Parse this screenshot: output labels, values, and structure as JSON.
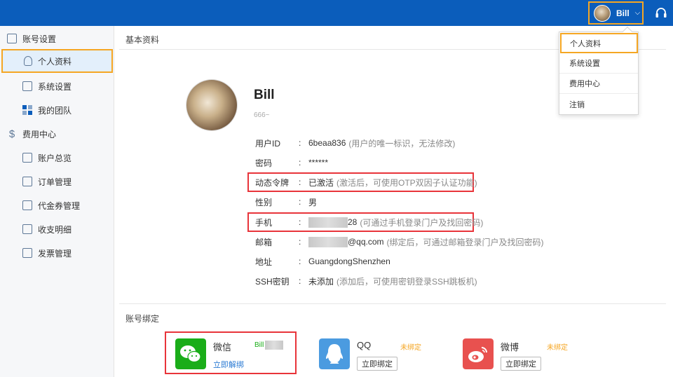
{
  "header": {
    "user_name": "Bill",
    "accent": "#0b5dbb"
  },
  "sidebar": {
    "groups": [
      {
        "label": "账号设置",
        "items": [
          {
            "label": "个人资料",
            "active": true
          },
          {
            "label": "系统设置"
          },
          {
            "label": "我的团队"
          }
        ]
      },
      {
        "label": "费用中心",
        "items": [
          {
            "label": "账户总览"
          },
          {
            "label": "订单管理"
          },
          {
            "label": "代金券管理"
          },
          {
            "label": "收支明细"
          },
          {
            "label": "发票管理"
          }
        ]
      }
    ]
  },
  "main": {
    "section_title": "基本资料",
    "profile": {
      "name": "Bill",
      "subtitle": "666~"
    },
    "fields": [
      {
        "key": "用户ID",
        "value": "6beaa836",
        "hint": "(用户的唯一标识，无法修改)"
      },
      {
        "key": "密码",
        "value": "******",
        "hint": ""
      },
      {
        "key": "动态令牌",
        "value": "已激活",
        "hint": "(激活后，可使用OTP双因子认证功能)"
      },
      {
        "key": "性别",
        "value": "男",
        "hint": ""
      },
      {
        "key": "手机",
        "value": "28",
        "hint": "(可通过手机登录门户及找回密码)"
      },
      {
        "key": "邮箱",
        "value": "@qq.com",
        "hint": "(绑定后，可通过邮箱登录门户及找回密码)"
      },
      {
        "key": "地址",
        "value": "GuangdongShenzhen",
        "hint": ""
      },
      {
        "key": "SSH密钥",
        "value": "未添加",
        "hint": "(添加后，可使用密钥登录SSH跳板机)"
      }
    ],
    "binding_title": "账号绑定",
    "bindings": [
      {
        "name": "微信",
        "status": "Bill",
        "action": "立即解绑",
        "icon": "wechat-icon",
        "color": "#1aad19"
      },
      {
        "name": "QQ",
        "status": "未绑定",
        "action": "立即绑定",
        "icon": "qq-icon",
        "color": "#4b9be0"
      },
      {
        "name": "微博",
        "status": "未绑定",
        "action": "立即绑定",
        "icon": "weibo-icon",
        "color": "#e8514f"
      }
    ]
  },
  "dropdown": {
    "items": [
      "个人资料",
      "系统设置",
      "费用中心",
      "注销"
    ],
    "selected": "个人资料"
  }
}
